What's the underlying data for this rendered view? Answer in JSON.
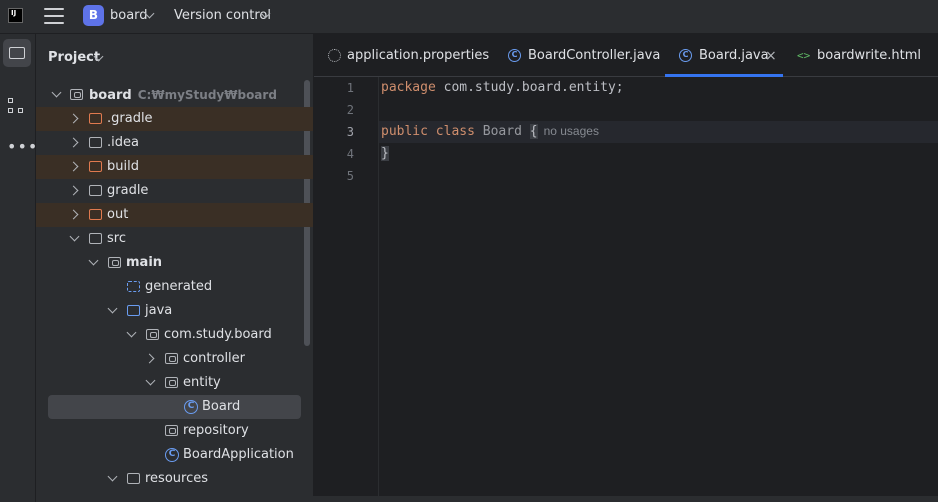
{
  "titlebar": {
    "project_initial": "B",
    "project_name": "board",
    "version_control": "Version control"
  },
  "project_panel": {
    "title": "Project",
    "tree": [
      {
        "label": "board",
        "hint": "C:₩myStudy₩board",
        "depth": 0,
        "expanded": true,
        "icon": "module-folder-icon",
        "bold": true
      },
      {
        "label": ".gradle",
        "depth": 1,
        "expanded": false,
        "icon": "excluded-folder-icon",
        "excluded": true
      },
      {
        "label": ".idea",
        "depth": 1,
        "expanded": false,
        "icon": "folder-icon"
      },
      {
        "label": "build",
        "depth": 1,
        "expanded": false,
        "icon": "excluded-folder-icon",
        "excluded": true
      },
      {
        "label": "gradle",
        "depth": 1,
        "expanded": false,
        "icon": "folder-icon"
      },
      {
        "label": "out",
        "depth": 1,
        "expanded": false,
        "icon": "excluded-folder-icon",
        "excluded": true
      },
      {
        "label": "src",
        "depth": 1,
        "expanded": true,
        "icon": "folder-icon"
      },
      {
        "label": "main",
        "depth": 2,
        "expanded": true,
        "icon": "module-folder-icon",
        "bold": true
      },
      {
        "label": "generated",
        "depth": 3,
        "icon": "generated-folder-icon"
      },
      {
        "label": "java",
        "depth": 3,
        "expanded": true,
        "icon": "source-folder-icon"
      },
      {
        "label": "com.study.board",
        "depth": 4,
        "expanded": true,
        "icon": "package-icon"
      },
      {
        "label": "controller",
        "depth": 5,
        "expanded": false,
        "icon": "package-icon"
      },
      {
        "label": "entity",
        "depth": 5,
        "expanded": true,
        "icon": "package-icon"
      },
      {
        "label": "Board",
        "depth": 6,
        "icon": "class-icon",
        "selected": true
      },
      {
        "label": "repository",
        "depth": 5,
        "icon": "package-icon"
      },
      {
        "label": "BoardApplication",
        "depth": 5,
        "icon": "spring-class-icon"
      },
      {
        "label": "resources",
        "depth": 3,
        "expanded": true,
        "icon": "resources-folder-icon"
      }
    ]
  },
  "editor": {
    "tabs": [
      {
        "label": "application.properties",
        "icon": "gear-icon"
      },
      {
        "label": "BoardController.java",
        "icon": "class-icon"
      },
      {
        "label": "Board.java",
        "icon": "class-icon",
        "active": true
      },
      {
        "label": "boardwrite.html",
        "icon": "html-icon"
      }
    ],
    "line_numbers": [
      "1",
      "2",
      "3",
      "4",
      "5"
    ],
    "current_line": 3,
    "code": {
      "line1_kw": "package",
      "line1_rest": " com.study.board.entity;",
      "line3_kw1": "public",
      "line3_kw2": "class",
      "line3_name": "Board",
      "line3_brace": "{",
      "line3_hint": "no usages",
      "line4": "}"
    }
  },
  "colors": {
    "accent": "#3574f0",
    "keyword": "#cf8e6d",
    "excluded_bg": "#3a2f25"
  }
}
